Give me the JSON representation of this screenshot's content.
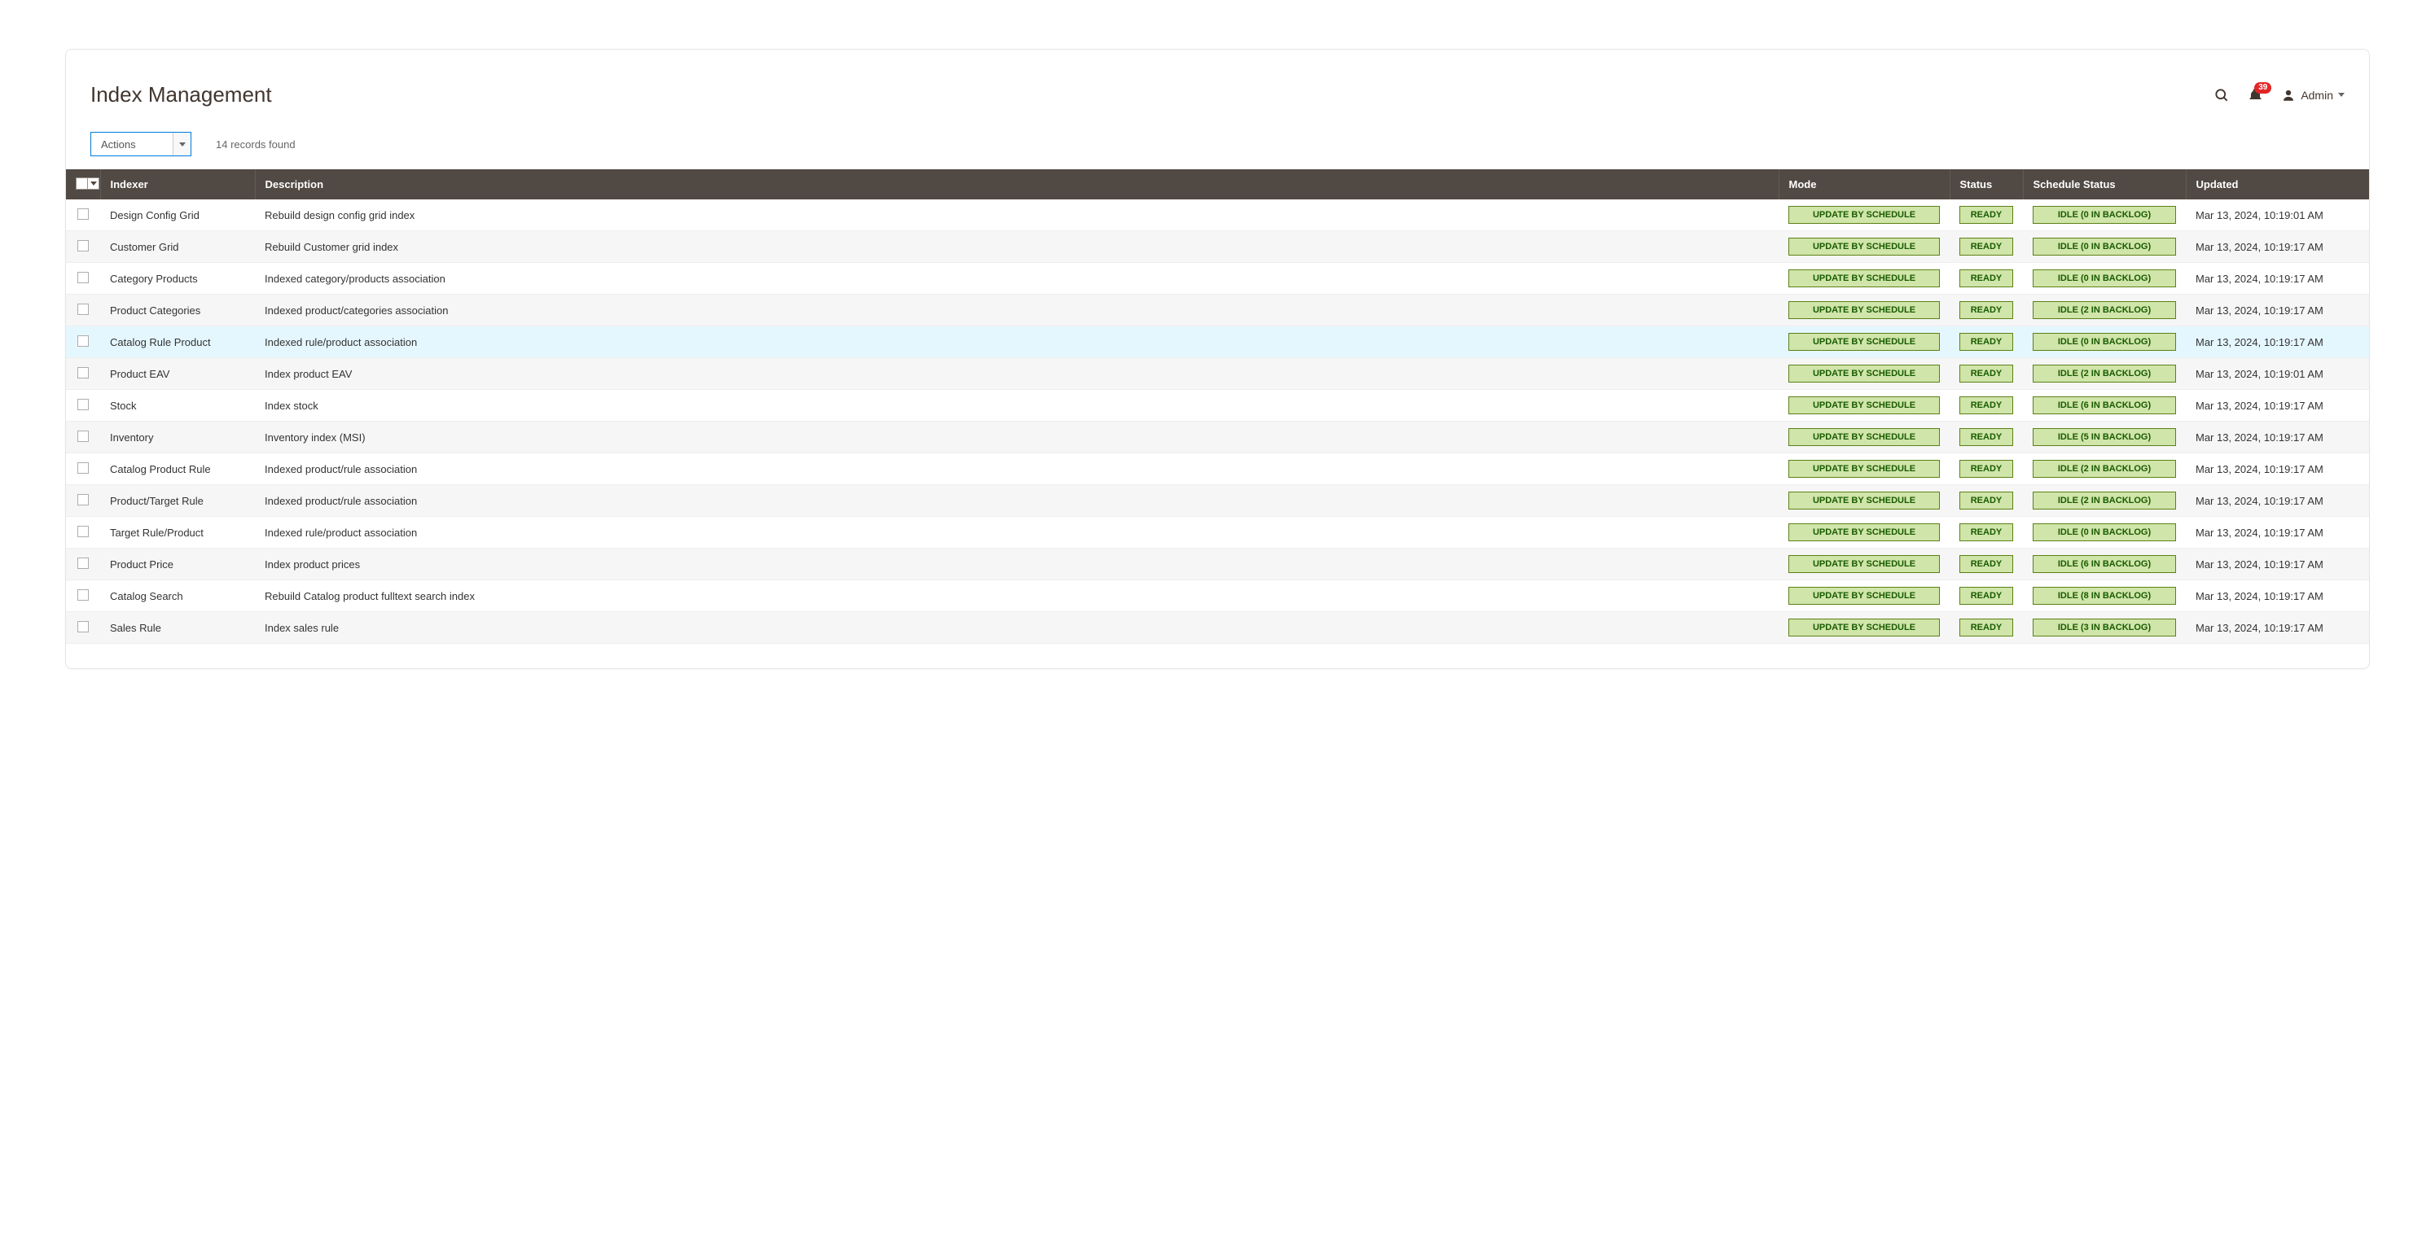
{
  "page_title": "Index Management",
  "header": {
    "notification_count": "39",
    "user_label": "Admin"
  },
  "controls": {
    "actions_label": "Actions",
    "records_found": "14 records found"
  },
  "columns": {
    "indexer": "Indexer",
    "description": "Description",
    "mode": "Mode",
    "status": "Status",
    "schedule_status": "Schedule Status",
    "updated": "Updated"
  },
  "rows": [
    {
      "indexer": "Design Config Grid",
      "description": "Rebuild design config grid index",
      "mode": "UPDATE BY SCHEDULE",
      "status": "READY",
      "schedule": "IDLE (0 IN BACKLOG)",
      "updated": "Mar 13, 2024, 10:19:01 AM",
      "highlight": false
    },
    {
      "indexer": "Customer Grid",
      "description": "Rebuild Customer grid index",
      "mode": "UPDATE BY SCHEDULE",
      "status": "READY",
      "schedule": "IDLE (0 IN BACKLOG)",
      "updated": "Mar 13, 2024, 10:19:17 AM",
      "highlight": false
    },
    {
      "indexer": "Category Products",
      "description": "Indexed category/products association",
      "mode": "UPDATE BY SCHEDULE",
      "status": "READY",
      "schedule": "IDLE (0 IN BACKLOG)",
      "updated": "Mar 13, 2024, 10:19:17 AM",
      "highlight": false
    },
    {
      "indexer": "Product Categories",
      "description": "Indexed product/categories association",
      "mode": "UPDATE BY SCHEDULE",
      "status": "READY",
      "schedule": "IDLE (2 IN BACKLOG)",
      "updated": "Mar 13, 2024, 10:19:17 AM",
      "highlight": false
    },
    {
      "indexer": "Catalog Rule Product",
      "description": "Indexed rule/product association",
      "mode": "UPDATE BY SCHEDULE",
      "status": "READY",
      "schedule": "IDLE (0 IN BACKLOG)",
      "updated": "Mar 13, 2024, 10:19:17 AM",
      "highlight": true
    },
    {
      "indexer": "Product EAV",
      "description": "Index product EAV",
      "mode": "UPDATE BY SCHEDULE",
      "status": "READY",
      "schedule": "IDLE (2 IN BACKLOG)",
      "updated": "Mar 13, 2024, 10:19:01 AM",
      "highlight": false
    },
    {
      "indexer": "Stock",
      "description": "Index stock",
      "mode": "UPDATE BY SCHEDULE",
      "status": "READY",
      "schedule": "IDLE (6 IN BACKLOG)",
      "updated": "Mar 13, 2024, 10:19:17 AM",
      "highlight": false
    },
    {
      "indexer": "Inventory",
      "description": "Inventory index (MSI)",
      "mode": "UPDATE BY SCHEDULE",
      "status": "READY",
      "schedule": "IDLE (5 IN BACKLOG)",
      "updated": "Mar 13, 2024, 10:19:17 AM",
      "highlight": false
    },
    {
      "indexer": "Catalog Product Rule",
      "description": "Indexed product/rule association",
      "mode": "UPDATE BY SCHEDULE",
      "status": "READY",
      "schedule": "IDLE (2 IN BACKLOG)",
      "updated": "Mar 13, 2024, 10:19:17 AM",
      "highlight": false
    },
    {
      "indexer": "Product/Target Rule",
      "description": "Indexed product/rule association",
      "mode": "UPDATE BY SCHEDULE",
      "status": "READY",
      "schedule": "IDLE (2 IN BACKLOG)",
      "updated": "Mar 13, 2024, 10:19:17 AM",
      "highlight": false
    },
    {
      "indexer": "Target Rule/Product",
      "description": "Indexed rule/product association",
      "mode": "UPDATE BY SCHEDULE",
      "status": "READY",
      "schedule": "IDLE (0 IN BACKLOG)",
      "updated": "Mar 13, 2024, 10:19:17 AM",
      "highlight": false
    },
    {
      "indexer": "Product Price",
      "description": "Index product prices",
      "mode": "UPDATE BY SCHEDULE",
      "status": "READY",
      "schedule": "IDLE (6 IN BACKLOG)",
      "updated": "Mar 13, 2024, 10:19:17 AM",
      "highlight": false
    },
    {
      "indexer": "Catalog Search",
      "description": "Rebuild Catalog product fulltext search index",
      "mode": "UPDATE BY SCHEDULE",
      "status": "READY",
      "schedule": "IDLE (8 IN BACKLOG)",
      "updated": "Mar 13, 2024, 10:19:17 AM",
      "highlight": false
    },
    {
      "indexer": "Sales Rule",
      "description": "Index sales rule",
      "mode": "UPDATE BY SCHEDULE",
      "status": "READY",
      "schedule": "IDLE (3 IN BACKLOG)",
      "updated": "Mar 13, 2024, 10:19:17 AM",
      "highlight": false
    }
  ]
}
